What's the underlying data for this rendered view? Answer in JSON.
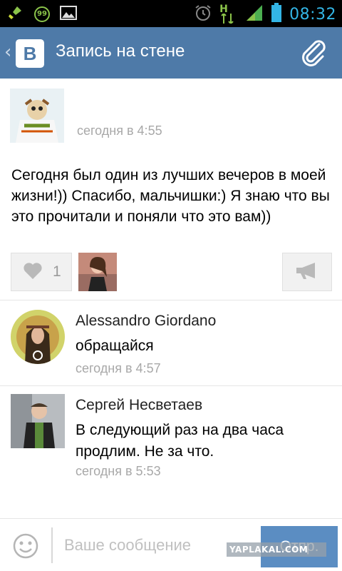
{
  "status_bar": {
    "time": "08:32",
    "notification_badge": "99",
    "network_label": "H",
    "icons": [
      "broom-icon",
      "badge-99-icon",
      "image-icon",
      "alarm-icon",
      "mobile-data-icon",
      "signal-icon",
      "battery-icon"
    ],
    "time_color": "#33b5e5"
  },
  "header": {
    "logo_letter": "B",
    "title": "Запись на стене",
    "background": "#4e7aa8",
    "icons": [
      "back-chevron-icon",
      "vk-logo",
      "paperclip-icon"
    ]
  },
  "post": {
    "time": "сегодня в 4:55",
    "text": "Сегодня был один из лучших вечеров в моей жизни!)) Спасибо, мальчишки:) Я знаю что вы это прочитали и поняли что это вам))",
    "like_count": "1",
    "icons": [
      "heart-icon",
      "megaphone-icon"
    ]
  },
  "comments": [
    {
      "name": "Alessandro Giordano",
      "text": "обращайся",
      "time": "сегодня в 4:57"
    },
    {
      "name": "Сергей Несветаев",
      "text": "В следующий раз на два часа продлим. Не за что.",
      "time": "сегодня в 5:53"
    }
  ],
  "compose": {
    "placeholder": "Ваше сообщение",
    "send_label": "Отпр.",
    "icons": [
      "emoji-icon"
    ]
  },
  "watermark": "YAPLAKAL.COM"
}
